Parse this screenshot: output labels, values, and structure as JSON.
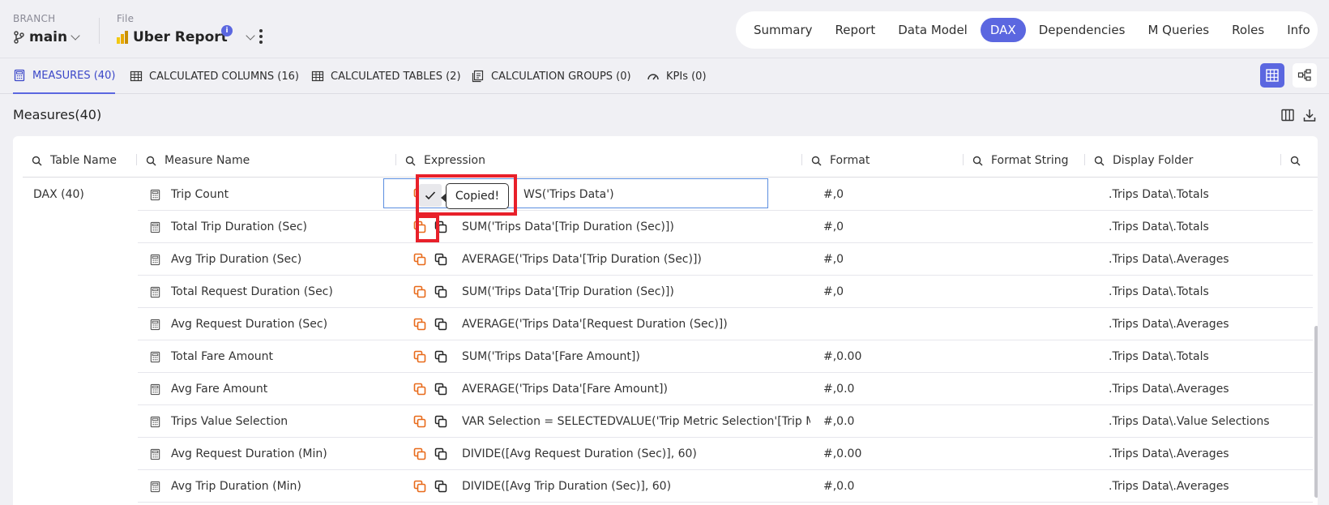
{
  "header": {
    "branch_label": "BRANCH",
    "branch_value": "main",
    "file_label": "File",
    "file_value": "Uber Report",
    "info_badge": "i"
  },
  "nav": [
    "Summary",
    "Report",
    "Data Model",
    "DAX",
    "Dependencies",
    "M Queries",
    "Roles",
    "Info"
  ],
  "nav_active": "DAX",
  "subtabs": [
    {
      "label": "MEASURES (40)",
      "icon": "calculator-icon"
    },
    {
      "label": "CALCULATED COLUMNS (16)",
      "icon": "table-column-icon"
    },
    {
      "label": "CALCULATED TABLES (2)",
      "icon": "table-icon"
    },
    {
      "label": "CALCULATION GROUPS (0)",
      "icon": "calculation-group-icon"
    },
    {
      "label": "KPIs (0)",
      "icon": "gauge-icon"
    }
  ],
  "section_title": "Measures(40)",
  "columns": [
    "Table Name",
    "Measure Name",
    "Expression",
    "Format",
    "Format String",
    "Display Folder"
  ],
  "group_label": "DAX (40)",
  "tooltip": "Copied!",
  "rows": [
    {
      "name": "Trip Count",
      "expression": "WS('Trips Data')",
      "format": "#,0",
      "folder": ".Trips Data\\.Totals"
    },
    {
      "name": "Total Trip Duration (Sec)",
      "expression": "SUM('Trips Data'[Trip Duration (Sec)])",
      "format": "#,0",
      "folder": ".Trips Data\\.Totals"
    },
    {
      "name": "Avg Trip Duration (Sec)",
      "expression": "AVERAGE('Trips Data'[Trip Duration (Sec)])",
      "format": "#,0",
      "folder": ".Trips Data\\.Averages"
    },
    {
      "name": "Total Request Duration (Sec)",
      "expression": "SUM('Trips Data'[Trip Duration (Sec)])",
      "format": "#,0",
      "folder": ".Trips Data\\.Totals"
    },
    {
      "name": "Avg Request Duration (Sec)",
      "expression": "AVERAGE('Trips Data'[Request Duration (Sec)])",
      "format": "",
      "folder": ".Trips Data\\.Averages"
    },
    {
      "name": "Total Fare Amount",
      "expression": "SUM('Trips Data'[Fare Amount])",
      "format": "#,0.00",
      "folder": ".Trips Data\\.Totals"
    },
    {
      "name": "Avg Fare Amount",
      "expression": "AVERAGE('Trips Data'[Fare Amount])",
      "format": "#,0.0",
      "folder": ".Trips Data\\.Averages"
    },
    {
      "name": "Trips Value Selection",
      "expression": "VAR Selection = SELECTEDVALUE('Trip Metric Selection'[Trip Me…",
      "format": "#,0.0",
      "folder": ".Trips Data\\.Value Selections"
    },
    {
      "name": "Avg Request Duration (Min)",
      "expression": "DIVIDE([Avg Request Duration (Sec)], 60)",
      "format": "#,0.00",
      "folder": ".Trips Data\\.Averages"
    },
    {
      "name": "Avg Trip Duration (Min)",
      "expression": "DIVIDE([Avg Trip Duration (Sec)], 60)",
      "format": "#,0.0",
      "folder": ".Trips Data\\.Averages"
    }
  ],
  "colors": {
    "accent": "#5b67e0",
    "highlight": "#e8202a",
    "copy_orange": "#e86a1a"
  }
}
